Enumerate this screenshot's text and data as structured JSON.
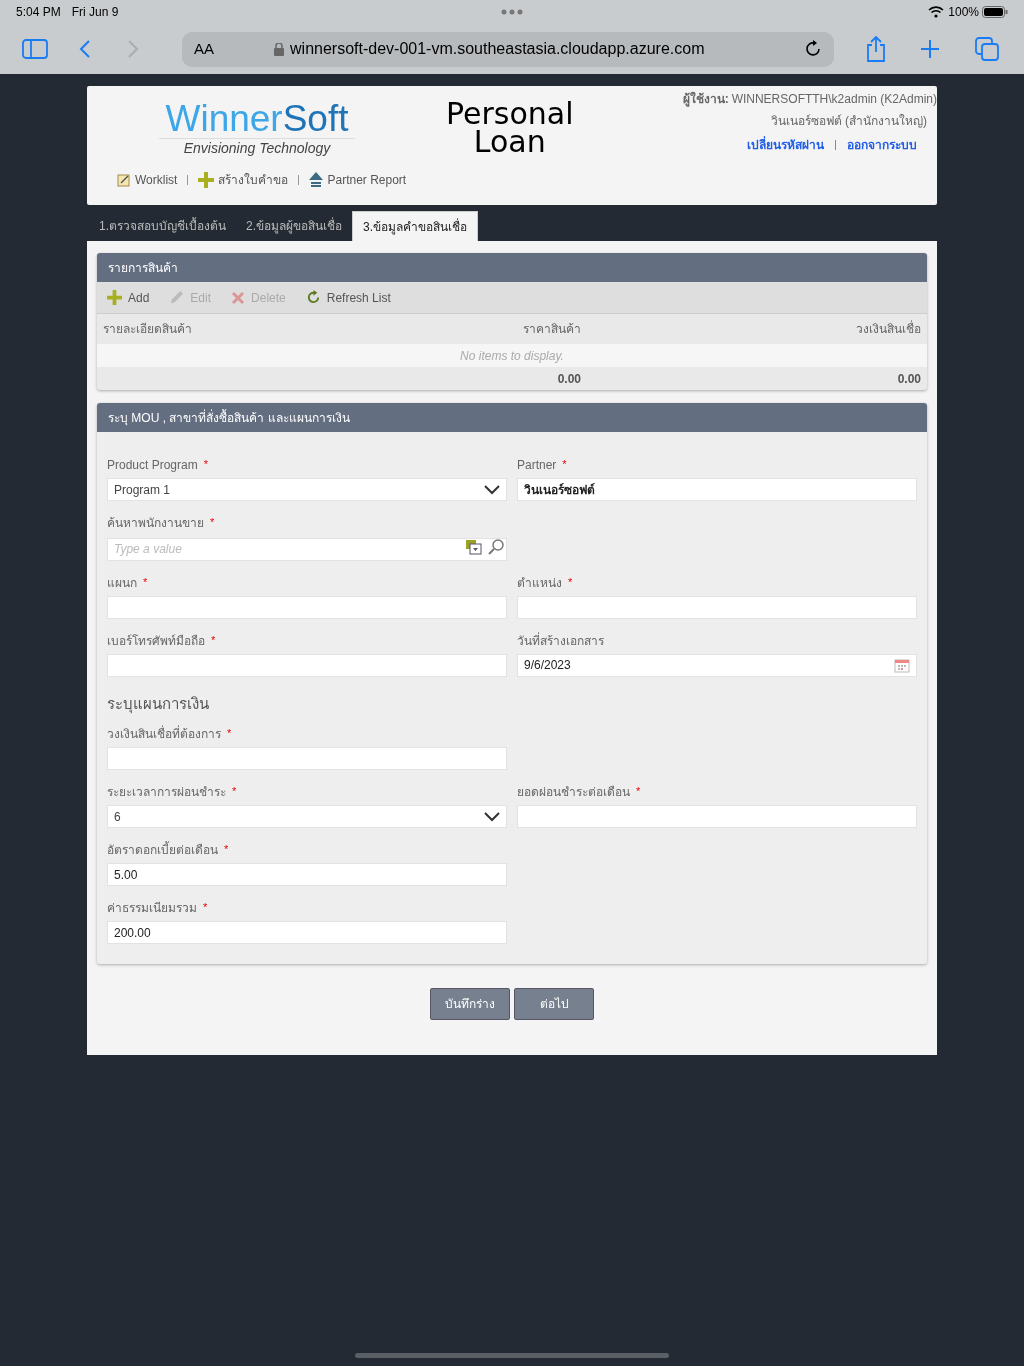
{
  "status_bar": {
    "time": "5:04 PM",
    "date": "Fri Jun 9",
    "battery": "100%"
  },
  "browser": {
    "text_size": "AA",
    "url": "winnersoft-dev-001-vm.southeastasia.cloudapp.azure.com",
    "back_enabled": true,
    "forward_enabled": false
  },
  "header": {
    "logo": {
      "word1": "Winner",
      "word2": "Soft",
      "tagline": "Envisioning Technology"
    },
    "title_line1": "Personal",
    "title_line2": "Loan",
    "nav": [
      {
        "kind": "worklist",
        "label": "Worklist"
      },
      {
        "kind": "create",
        "label": "สร้างใบคำขอ"
      },
      {
        "kind": "report",
        "label": "Partner Report"
      }
    ],
    "user_label": "ผู้ใช้งาน:",
    "user": "WINNERSOFTTH\\k2admin (K2Admin)",
    "branch": "วินเนอร์ซอฟต์ (สำนักงานใหญ่)",
    "links": [
      "เปลี่ยนรหัสผ่าน",
      "ออกจากระบบ"
    ]
  },
  "tabs": [
    {
      "label": "1.ตรวจสอบบัญชีเบื้องต้น",
      "selected": false
    },
    {
      "label": "2.ข้อมูลผู้ขอสินเชื่อ",
      "selected": false
    },
    {
      "label": "3.ข้อมูลคำขอสินเชื่อ",
      "selected": true
    }
  ],
  "items_panel": {
    "title": "รายการสินค้า",
    "toolbar": [
      {
        "kind": "add",
        "label": "Add",
        "disabled": false
      },
      {
        "kind": "edit",
        "label": "Edit",
        "disabled": true
      },
      {
        "kind": "delete",
        "label": "Delete",
        "disabled": true
      },
      {
        "kind": "refresh",
        "label": "Refresh List",
        "disabled": false
      }
    ],
    "columns": [
      "รายละเอียดสินค้า",
      "ราคาสินค้า",
      "วงเงินสินเชื่อ"
    ],
    "empty_message": "No items to display.",
    "totals": [
      "0.00",
      "0.00"
    ]
  },
  "form_panel": {
    "title": "ระบุ MOU , สาขาที่สั่งซื้อสินค้า และแผนการเงิน",
    "rows": [
      [
        {
          "kind": "select",
          "label": "Product Program",
          "mark": "*",
          "value": "Program 1"
        },
        {
          "kind": "text",
          "label": "Partner",
          "mark": "*",
          "value": "วินเนอร์ซอฟต์",
          "bold": true
        }
      ],
      [
        {
          "kind": "lookup",
          "label": "ค้นหาพนักงานขาย",
          "mark": "*",
          "placeholder": "Type a value"
        }
      ],
      [
        {
          "kind": "text",
          "label": "แผนก",
          "mark": "*"
        },
        {
          "kind": "text",
          "label": "ตำแหน่ง",
          "mark": "*"
        }
      ],
      [
        {
          "kind": "text",
          "label": "เบอร์โทรศัพท์มือถือ",
          "mark": "*"
        },
        {
          "kind": "date",
          "label": "วันที่สร้างเอกสาร",
          "value": "9/6/2023"
        }
      ]
    ],
    "plan_heading": "ระบุแผนการเงิน",
    "plan_rows": [
      [
        {
          "kind": "text",
          "label": "วงเงินสินเชื่อที่ต้องการ",
          "mark": "*"
        }
      ],
      [
        {
          "kind": "select",
          "label": "ระยะเวลาการผ่อนชำระ",
          "mark": "*",
          "value": "6"
        },
        {
          "kind": "text",
          "label": "ยอดผ่อนชำระต่อเดือน",
          "mark": "*"
        }
      ],
      [
        {
          "kind": "text",
          "label": "อัตราดอกเบี้ยต่อเดือน",
          "mark": "*",
          "value": "5.00"
        }
      ],
      [
        {
          "kind": "text",
          "label": "ค่าธรรมเนียมรวม",
          "mark": "*",
          "value": "200.00"
        }
      ]
    ]
  },
  "buttons": [
    "บันทึกร่าง",
    "ต่อไป"
  ]
}
